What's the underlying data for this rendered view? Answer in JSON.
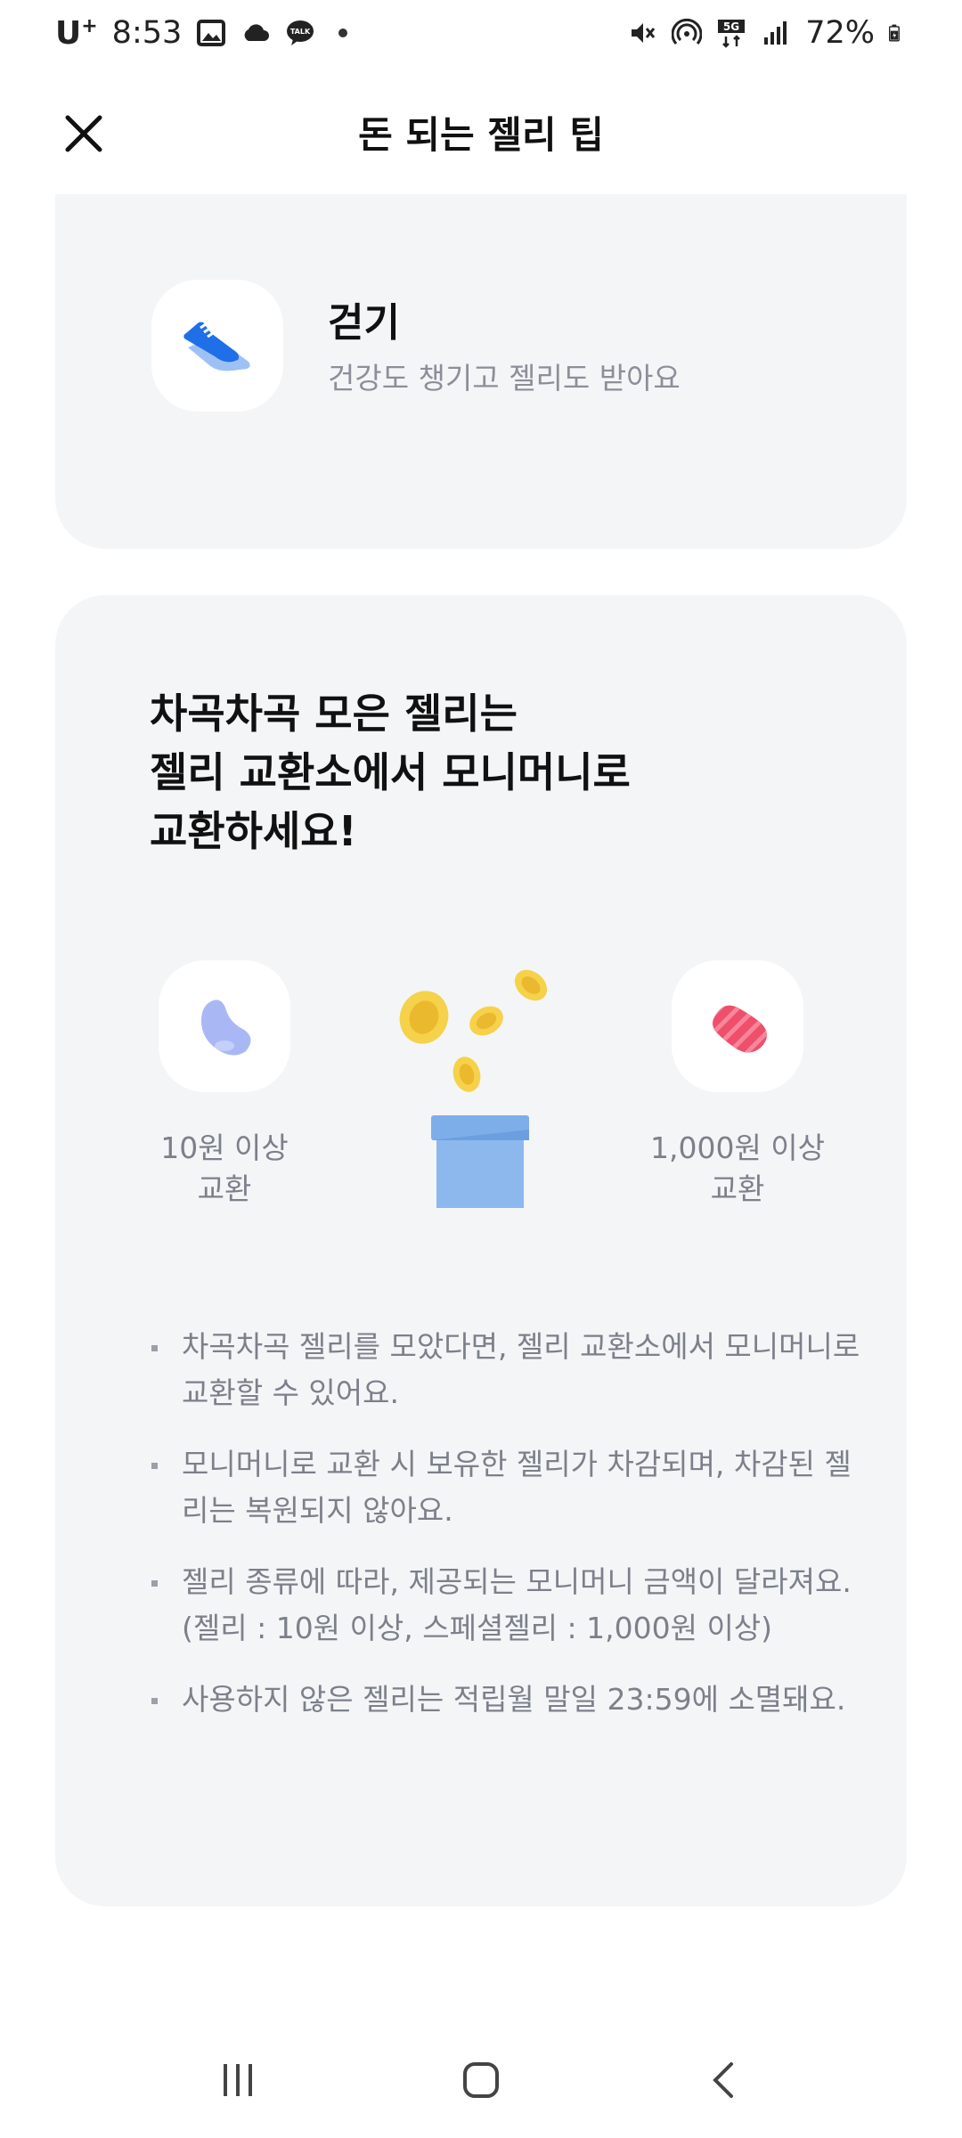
{
  "status_bar": {
    "carrier": "U",
    "carrier_plus": "+",
    "time": "8:53",
    "battery": "72%",
    "icons": [
      "image-icon",
      "cloud-icon",
      "talk-icon",
      "dot-icon",
      "mute-icon",
      "hotspot-icon",
      "5g-icon",
      "signal-icon",
      "battery-icon"
    ],
    "talk_label": "TALK",
    "network_label": "5G"
  },
  "header": {
    "title": "돈 되는 젤리 팁",
    "close_icon": "close-icon"
  },
  "walk_card": {
    "title": "걷기",
    "subtitle": "건강도 챙기고 젤리도 받아요",
    "icon": "shoe-icon"
  },
  "exchange_card": {
    "heading_lines": [
      "차곡차곡 모은 젤리는",
      "젤리 교환소에서 모니머니로",
      "교환하세요!"
    ],
    "left": {
      "icon": "blue-jelly-icon",
      "caption_line1": "10원 이상",
      "caption_line2": "교환"
    },
    "center": {
      "icon": "coin-box-icon"
    },
    "right": {
      "icon": "red-jelly-icon",
      "caption_line1": "1,000원 이상",
      "caption_line2": "교환"
    },
    "notes": [
      "차곡차곡 젤리를 모았다면, 젤리 교환소에서 모니머니로 교환할 수 있어요.",
      "모니머니로 교환 시 보유한 젤리가 차감되며, 차감된 젤리는 복원되지 않아요.",
      "젤리 종류에 따라, 제공되는 모니머니 금액이 달라져요. (젤리 : 10원 이상, 스페셜젤리 : 1,000원 이상)",
      "사용하지 않은 젤리는 적립월 말일 23:59에 소멸돼요."
    ]
  },
  "colors": {
    "card_bg": "#f4f5f7",
    "shoe_blue": "#1f6fe8",
    "jelly_blue": "#a9b8f5",
    "jelly_red": "#ef4f6b",
    "coin_yellow": "#f5d24a",
    "box_blue": "#8cb8ee"
  }
}
